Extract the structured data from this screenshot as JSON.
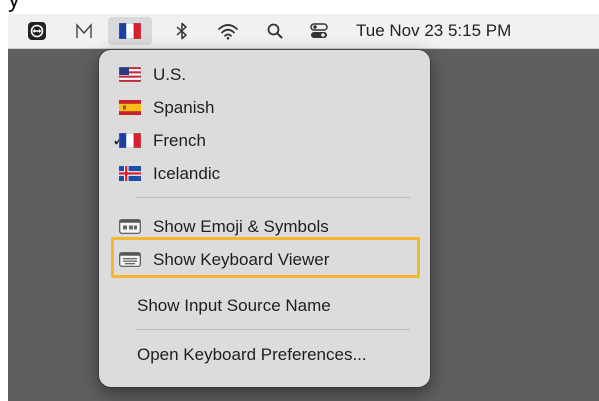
{
  "menubar": {
    "items": [
      {
        "icon": "teamviewer-icon"
      },
      {
        "icon": "m-app-icon"
      },
      {
        "icon": "french-flag-icon"
      },
      {
        "icon": "bluetooth-icon"
      },
      {
        "icon": "wifi-icon"
      },
      {
        "icon": "search-icon"
      },
      {
        "icon": "control-center-icon"
      }
    ],
    "datetime": "Tue Nov 23  5:15 PM"
  },
  "menu": {
    "languages": [
      {
        "label": "U.S.",
        "icon": "us-flag-icon",
        "checked": false
      },
      {
        "label": "Spanish",
        "icon": "spain-flag-icon",
        "checked": false
      },
      {
        "label": "French",
        "icon": "france-flag-icon",
        "checked": true
      },
      {
        "label": "Icelandic",
        "icon": "iceland-flag-icon",
        "checked": false
      }
    ],
    "check_glyph": "✓",
    "show_emoji": "Show Emoji & Symbols",
    "show_keyboard_viewer": "Show Keyboard Viewer",
    "show_input_source_name": "Show Input Source Name",
    "open_keyboard_prefs": "Open Keyboard Preferences..."
  },
  "colors": {
    "highlight": "#f3b731",
    "desktop": "#5f5f5f",
    "menu_bg": "#dcdcdc"
  }
}
